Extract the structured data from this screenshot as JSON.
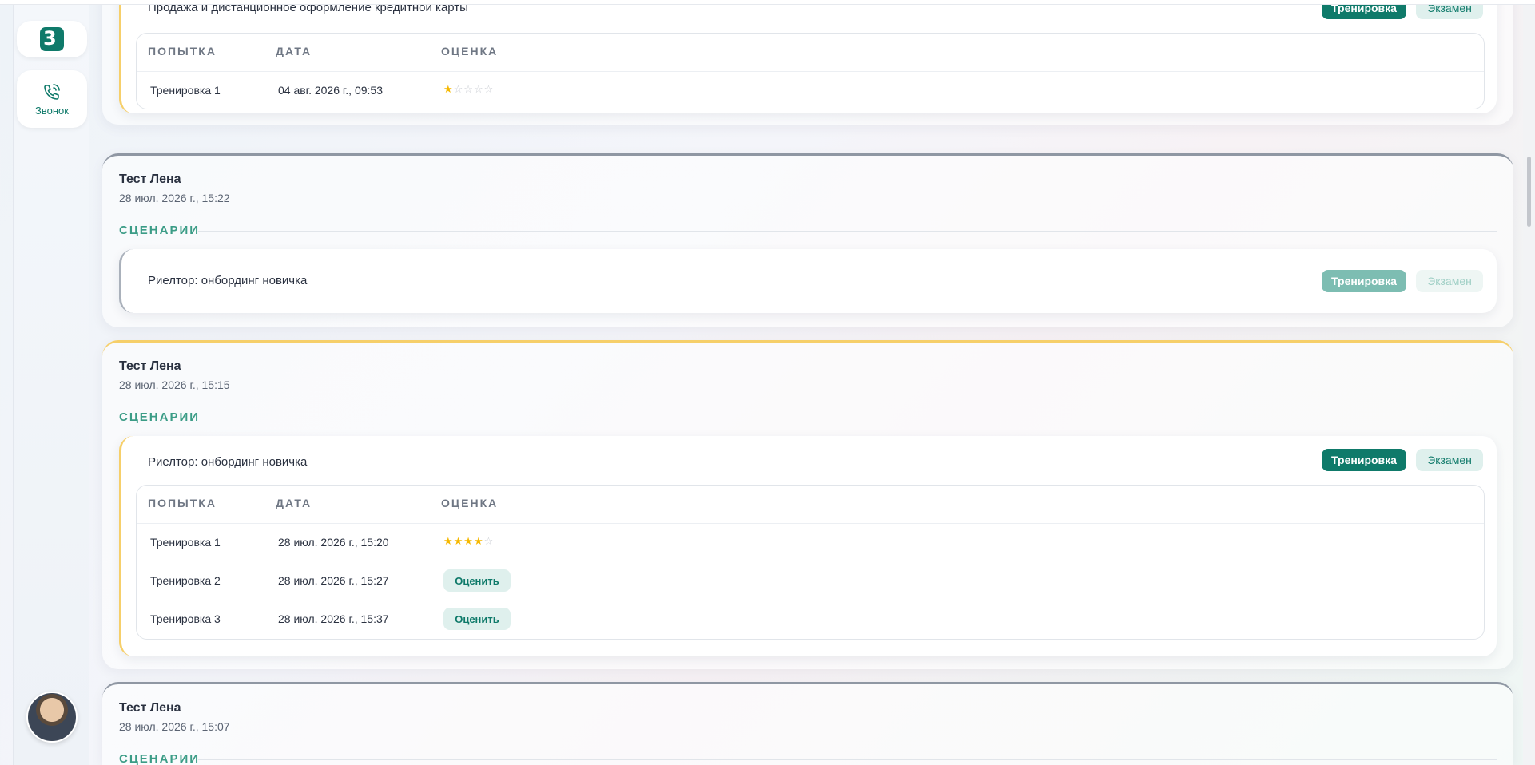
{
  "sidebar": {
    "logo_text": "3",
    "call_label": "Звонок"
  },
  "card1": {
    "scenario": {
      "name": "Продажа и дистанционное оформление кредитной карты",
      "train_label": "Тренировка",
      "exam_label": "Экзамен"
    },
    "table": {
      "col_attempt": "ПОПЫТКА",
      "col_date": "ДАТА",
      "col_rating": "ОЦЕНКА",
      "rows": [
        {
          "attempt": "Тренировка 1",
          "date": "04 авг. 2026 г., 09:53",
          "stars": 1
        }
      ]
    }
  },
  "card2": {
    "title": "Тест Лена",
    "date": "28 июл. 2026 г., 15:22",
    "section": "СЦЕНАРИИ",
    "scenario": {
      "name": "Риелтор: онбординг новичка",
      "train_label": "Тренировка",
      "exam_label": "Экзамен"
    }
  },
  "card3": {
    "title": "Тест Лена",
    "date": "28 июл. 2026 г., 15:15",
    "section": "СЦЕНАРИИ",
    "scenario": {
      "name": "Риелтор: онбординг новичка",
      "train_label": "Тренировка",
      "exam_label": "Экзамен"
    },
    "table": {
      "col_attempt": "ПОПЫТКА",
      "col_date": "ДАТА",
      "col_rating": "ОЦЕНКА",
      "rows": [
        {
          "attempt": "Тренировка 1",
          "date": "28 июл. 2026 г., 15:20",
          "stars": 4
        },
        {
          "attempt": "Тренировка 2",
          "date": "28 июл. 2026 г., 15:27",
          "rate_label": "Оценить"
        },
        {
          "attempt": "Тренировка 3",
          "date": "28 июл. 2026 г., 15:37",
          "rate_label": "Оценить"
        }
      ]
    }
  },
  "card4": {
    "title": "Тест Лена",
    "date": "28 июл. 2026 г., 15:07",
    "section": "СЦЕНАРИИ"
  },
  "colors": {
    "accent": "#0f7a6a",
    "section": "#3b9c86",
    "star": "#f5b800",
    "yellow_accent": "#f6cf6a"
  }
}
